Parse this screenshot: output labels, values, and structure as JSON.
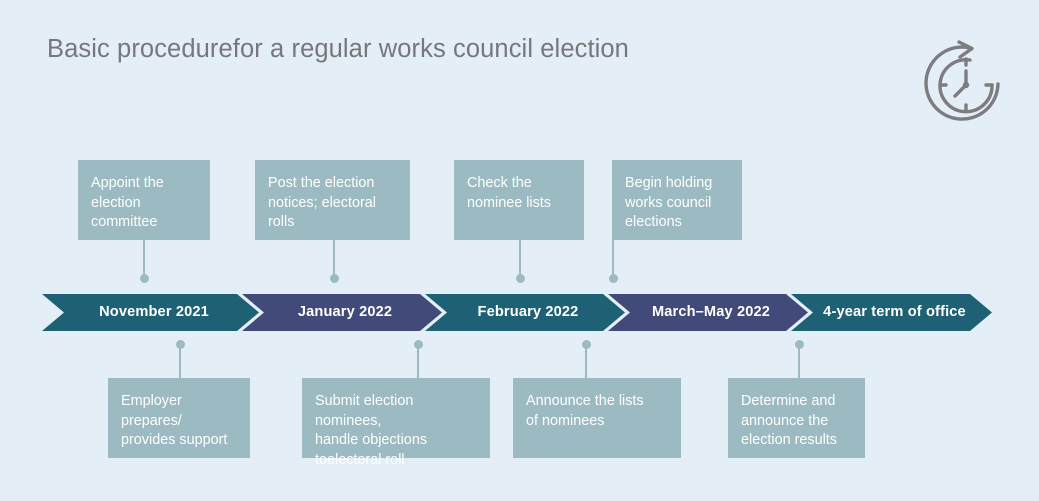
{
  "page": {
    "title": "Basic procedurefor a regular works council election",
    "background_color": "#e4eef6",
    "title_color": "#77777b"
  },
  "icons": {
    "clock": {
      "name": "clock-rotate-icon",
      "color": "#7d7d81"
    }
  },
  "colors": {
    "teal": "#1e6175",
    "navy": "#414a78",
    "box_fill": "#9bbac2",
    "connector": "#9bbac2",
    "text_on_fill": "#ffffff"
  },
  "timeline": {
    "segments": [
      {
        "label": "November 2021",
        "color": "#1e6175"
      },
      {
        "label": "January 2022",
        "color": "#414a78"
      },
      {
        "label": "February 2022",
        "color": "#1e6175"
      },
      {
        "label": "March–May 2022",
        "color": "#414a78"
      },
      {
        "label": "4-year term of office",
        "color": "#1e6175"
      }
    ]
  },
  "notes_above": [
    {
      "text": "Appoint the\nelection\ncommittee"
    },
    {
      "text": "Post the election\nnotices; electoral\nrolls"
    },
    {
      "text": "Check the\nnominee lists"
    },
    {
      "text": "Begin holding\nworks council\nelections"
    }
  ],
  "notes_below": [
    {
      "text": "Employer\nprepares/\nprovides support"
    },
    {
      "text": "Submit election nominees,\nhandle objections\ntoelectoral roll"
    },
    {
      "text": "Announce the lists\nof nominees"
    },
    {
      "text": "Determine and\nannounce the\nelection results"
    }
  ]
}
